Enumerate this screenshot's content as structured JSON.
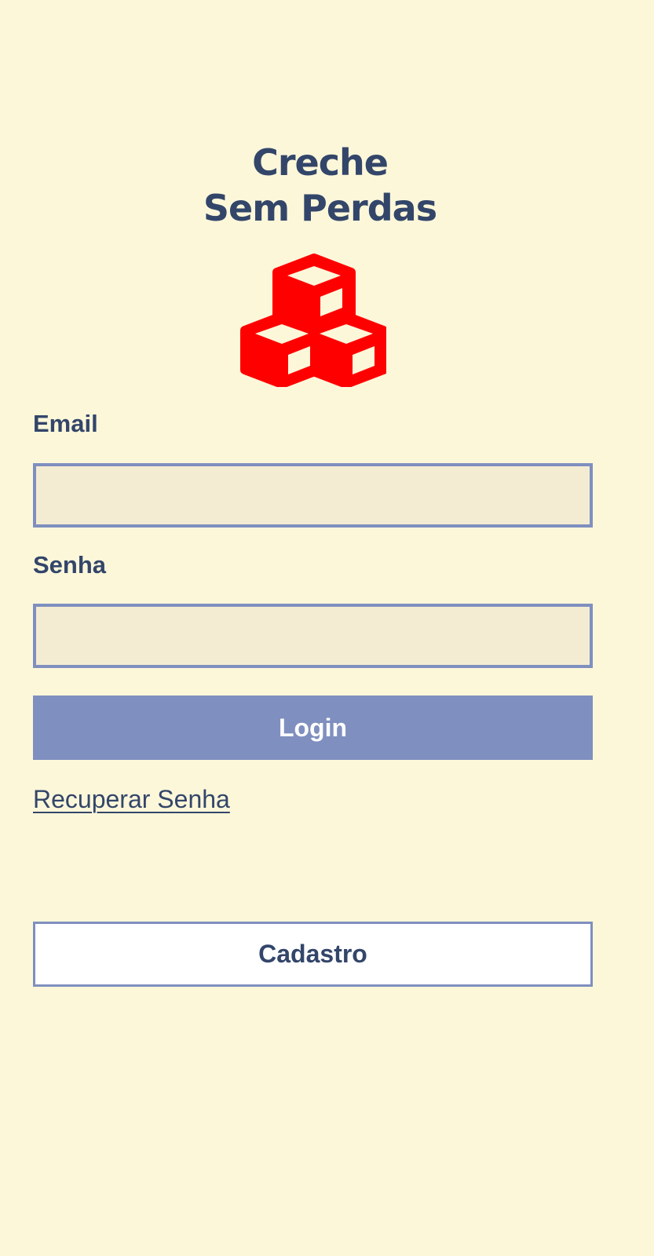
{
  "header": {
    "title_line1": "Creche",
    "title_line2": "Sem Perdas",
    "logo_icon": "cubes-icon",
    "logo_color": "#ff0000"
  },
  "form": {
    "email_label": "Email",
    "email_value": "",
    "email_placeholder": "",
    "password_label": "Senha",
    "password_value": "",
    "password_placeholder": "",
    "login_label": "Login",
    "recover_label": "Recuperar Senha",
    "signup_label": "Cadastro"
  },
  "colors": {
    "background": "#fdf7da",
    "text": "#33466a",
    "accent": "#7f8fbf",
    "input_fill": "#f4ecd2"
  }
}
